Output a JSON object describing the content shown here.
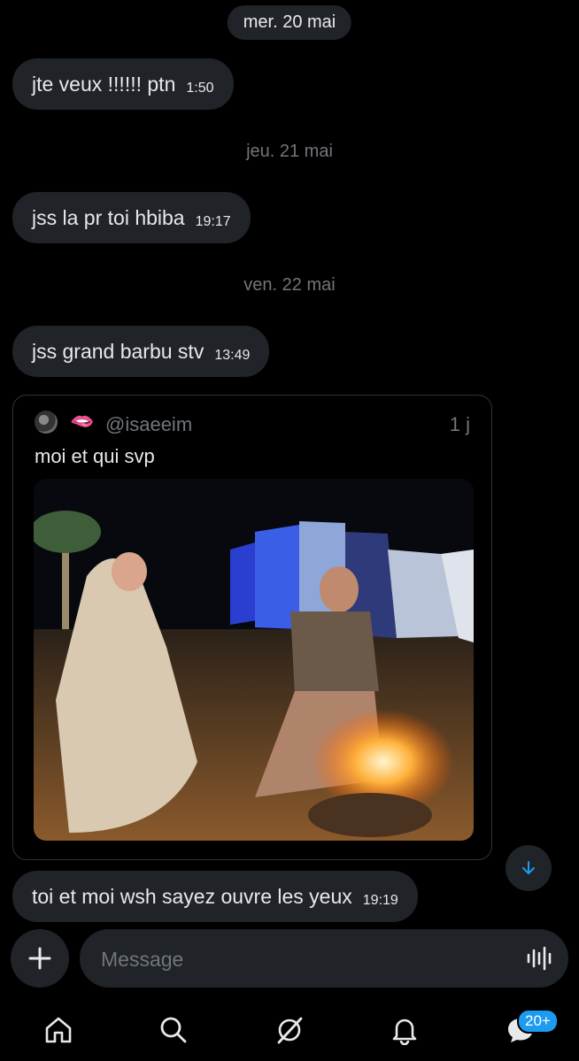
{
  "dates": [
    "mer. 20 mai",
    "jeu. 21 mai",
    "ven. 22 mai"
  ],
  "messages": [
    {
      "text": "jte veux !!!!!! ptn",
      "time": "1:50"
    },
    {
      "text": "jss la pr toi hbiba",
      "time": "19:17"
    },
    {
      "text": "jss grand barbu stv",
      "time": "13:49"
    },
    {
      "text": "toi et moi wsh sayez ouvre les yeux",
      "time": "19:19"
    }
  ],
  "quoted_post": {
    "emoji": "🫦",
    "handle": "@isaeeim",
    "age": "1 j",
    "text": "moi et qui svp"
  },
  "composer": {
    "placeholder": "Message"
  },
  "tabs": {
    "icons": [
      "home-icon",
      "search-icon",
      "grok-icon",
      "notifications-icon",
      "messages-icon"
    ],
    "messages_badge": "20+"
  },
  "colors": {
    "background": "#000000",
    "bubble": "#202327",
    "muted": "#71767b",
    "accent": "#1d9bf0"
  }
}
